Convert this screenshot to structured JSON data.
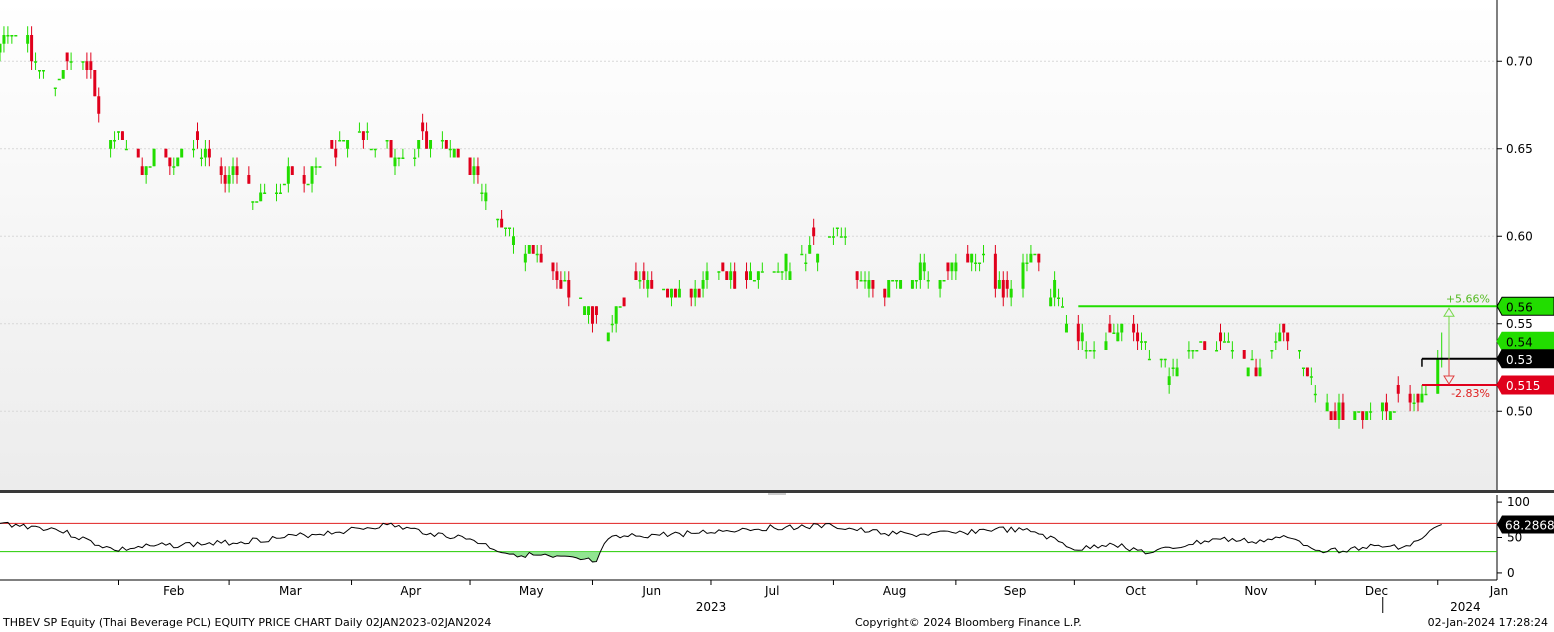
{
  "footer": {
    "left": "THBEV SP Equity (Thai Beverage PCL) EQUITY PRICE CHART  Daily 02JAN2023-02JAN2024",
    "center": "Copyright© 2024 Bloomberg Finance L.P.",
    "right": "02-Jan-2024 17:28:24"
  },
  "colors": {
    "up": "#22dd00",
    "down": "#e0001c",
    "resistance": "#22dd00",
    "support": "#e0001c",
    "last": "#000000",
    "rsi_upper": "#e02020",
    "rsi_lower": "#22cc00",
    "rsi_fill": "#7fe07f"
  },
  "chart_data": [
    {
      "type": "candlestick",
      "title": "THBEV SP Equity (Thai Beverage PCL) EQUITY PRICE CHART",
      "period": "Daily 02JAN2023-02JAN2024",
      "ylim": [
        0.455,
        0.735
      ],
      "y_ticks": [
        "0.50",
        "0.55",
        "0.60",
        "0.65",
        "0.70"
      ],
      "x_month_labels": [
        "Feb",
        "Mar",
        "Apr",
        "May",
        "Jun",
        "Jul",
        "Aug",
        "Sep",
        "Oct",
        "Nov",
        "Dec",
        "Jan"
      ],
      "x_year_labels": [
        "2023",
        "2024"
      ],
      "close_path": [
        [
          "2023-01-02",
          0.71
        ],
        [
          "2023-01-05",
          0.72
        ],
        [
          "2023-01-10",
          0.705
        ],
        [
          "2023-01-16",
          0.69
        ],
        [
          "2023-01-20",
          0.7
        ],
        [
          "2023-01-24",
          0.7
        ],
        [
          "2023-01-26",
          0.68
        ],
        [
          "2023-01-30",
          0.66
        ],
        [
          "2023-02-02",
          0.65
        ],
        [
          "2023-02-06",
          0.64
        ],
        [
          "2023-02-10",
          0.645
        ],
        [
          "2023-02-14",
          0.64
        ],
        [
          "2023-02-17",
          0.645
        ],
        [
          "2023-02-21",
          0.655
        ],
        [
          "2023-02-24",
          0.645
        ],
        [
          "2023-02-27",
          0.63
        ],
        [
          "2023-03-03",
          0.64
        ],
        [
          "2023-03-08",
          0.62
        ],
        [
          "2023-03-13",
          0.625
        ],
        [
          "2023-03-17",
          0.64
        ],
        [
          "2023-03-22",
          0.635
        ],
        [
          "2023-03-27",
          0.645
        ],
        [
          "2023-03-31",
          0.655
        ],
        [
          "2023-04-04",
          0.66
        ],
        [
          "2023-04-07",
          0.655
        ],
        [
          "2023-04-12",
          0.645
        ],
        [
          "2023-04-17",
          0.65
        ],
        [
          "2023-04-21",
          0.655
        ],
        [
          "2023-04-26",
          0.655
        ],
        [
          "2023-05-02",
          0.635
        ],
        [
          "2023-05-05",
          0.625
        ],
        [
          "2023-05-10",
          0.605
        ],
        [
          "2023-05-15",
          0.59
        ],
        [
          "2023-05-19",
          0.585
        ],
        [
          "2023-05-24",
          0.575
        ],
        [
          "2023-05-29",
          0.565
        ],
        [
          "2023-06-01",
          0.555
        ],
        [
          "2023-06-05",
          0.545
        ],
        [
          "2023-06-08",
          0.56
        ],
        [
          "2023-06-12",
          0.575
        ],
        [
          "2023-06-16",
          0.575
        ],
        [
          "2023-06-21",
          0.57
        ],
        [
          "2023-06-26",
          0.565
        ],
        [
          "2023-06-30",
          0.575
        ],
        [
          "2023-07-05",
          0.575
        ],
        [
          "2023-07-10",
          0.58
        ],
        [
          "2023-07-14",
          0.575
        ],
        [
          "2023-07-19",
          0.585
        ],
        [
          "2023-07-24",
          0.59
        ],
        [
          "2023-07-28",
          0.595
        ],
        [
          "2023-08-01",
          0.605
        ],
        [
          "2023-08-04",
          0.595
        ],
        [
          "2023-08-08",
          0.575
        ],
        [
          "2023-08-14",
          0.57
        ],
        [
          "2023-08-18",
          0.575
        ],
        [
          "2023-08-23",
          0.58
        ],
        [
          "2023-08-28",
          0.575
        ],
        [
          "2023-09-01",
          0.585
        ],
        [
          "2023-09-06",
          0.59
        ],
        [
          "2023-09-11",
          0.575
        ],
        [
          "2023-09-15",
          0.565
        ],
        [
          "2023-09-18",
          0.59
        ],
        [
          "2023-09-22",
          0.585
        ],
        [
          "2023-09-27",
          0.565
        ],
        [
          "2023-10-02",
          0.545
        ],
        [
          "2023-10-06",
          0.535
        ],
        [
          "2023-10-10",
          0.545
        ],
        [
          "2023-10-13",
          0.55
        ],
        [
          "2023-10-17",
          0.545
        ],
        [
          "2023-10-20",
          0.535
        ],
        [
          "2023-10-25",
          0.525
        ],
        [
          "2023-10-30",
          0.54
        ],
        [
          "2023-11-03",
          0.54
        ],
        [
          "2023-11-08",
          0.535
        ],
        [
          "2023-11-13",
          0.53
        ],
        [
          "2023-11-17",
          0.525
        ],
        [
          "2023-11-22",
          0.54
        ],
        [
          "2023-11-27",
          0.535
        ],
        [
          "2023-12-01",
          0.51
        ],
        [
          "2023-12-06",
          0.5
        ],
        [
          "2023-12-11",
          0.495
        ],
        [
          "2023-12-15",
          0.5
        ],
        [
          "2023-12-20",
          0.505
        ],
        [
          "2023-12-25",
          0.505
        ],
        [
          "2023-12-28",
          0.515
        ],
        [
          "2024-01-02",
          0.53
        ]
      ],
      "last_candle": {
        "date": "2024-01-02",
        "open": 0.53,
        "high": 0.545,
        "low": 0.525,
        "close": 0.53
      },
      "resistance": {
        "value": 0.56,
        "label": "0.56",
        "pct_label": "+5.66%",
        "start_date": "2023-10-02"
      },
      "support": {
        "value": 0.515,
        "label": "0.515",
        "pct_label": "-2.83%",
        "start_date": "2023-12-28"
      },
      "last_price": {
        "value": 0.53,
        "label": "0.53",
        "start_date": "2023-12-28"
      },
      "current_tag": {
        "value": 0.54,
        "label": "0.54"
      }
    },
    {
      "type": "line",
      "title": "",
      "ylim": [
        -10,
        110
      ],
      "y_ticks": [
        "0",
        "50",
        "100"
      ],
      "upper_line": 70,
      "lower_line": 30,
      "last_value_label": "68.2868",
      "series": [
        {
          "name": "",
          "x": [
            "2023-01-02",
            "2023-01-16",
            "2023-01-31",
            "2023-02-10",
            "2023-02-27",
            "2023-03-15",
            "2023-03-31",
            "2023-04-10",
            "2023-04-21",
            "2023-05-01",
            "2023-05-10",
            "2023-05-22",
            "2023-06-02",
            "2023-06-05",
            "2023-06-12",
            "2023-06-26",
            "2023-07-10",
            "2023-07-20",
            "2023-08-01",
            "2023-08-10",
            "2023-08-21",
            "2023-09-01",
            "2023-09-11",
            "2023-09-21",
            "2023-10-02",
            "2023-10-10",
            "2023-10-20",
            "2023-10-30",
            "2023-11-06",
            "2023-11-15",
            "2023-11-24",
            "2023-12-04",
            "2023-12-13",
            "2023-12-25",
            "2024-01-02"
          ],
          "values": [
            70,
            62,
            32,
            38,
            42,
            50,
            60,
            68,
            56,
            48,
            28,
            22,
            16,
            48,
            52,
            56,
            62,
            65,
            66,
            58,
            54,
            56,
            62,
            58,
            32,
            42,
            28,
            40,
            48,
            44,
            50,
            30,
            36,
            38,
            68.29
          ]
        }
      ]
    }
  ]
}
